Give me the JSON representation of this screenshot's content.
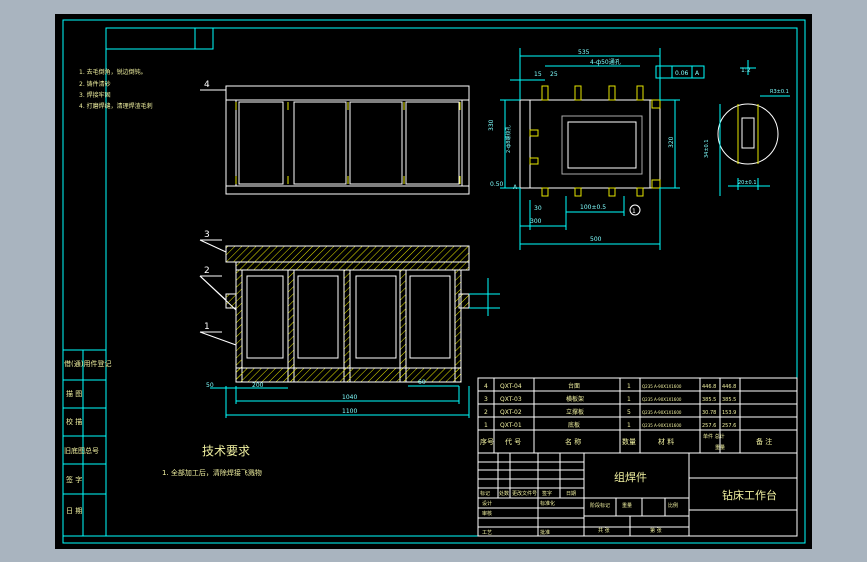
{
  "colors": {
    "background_outer": "#a9b4bf",
    "sheet": "#000000",
    "border": "#00ffff",
    "outline": "#ffffff",
    "hatch": "#e6e600",
    "dimension": "#00ffff",
    "text": "#f0f0a0"
  },
  "notes_top": [
    "1. 去毛倒角，锐边倒钝。",
    "2. 铸件清砂",
    "3. 焊接牢固",
    "4. 打磨焊缝，清理焊渣毛刺"
  ],
  "balloons": {
    "part4": "4",
    "part3": "3",
    "part2": "2",
    "part1": "1"
  },
  "tech_requirements": {
    "title": "技术要求",
    "line1": "1. 全部加工后，清除焊接飞溅物"
  },
  "dimensions": {
    "top_span": "535",
    "holes": "4-ф50通孔",
    "left_dim": "15",
    "small_25": "25",
    "left_height": "330",
    "side_holes": "2-ф8螺纹孔",
    "right_height": "320",
    "corner": "0.50",
    "dim_300": "300",
    "dim_100": "100±0.5",
    "dim_500": "500",
    "bottom_section_1040": "1040",
    "bottom_section_1100": "1100",
    "detail_12": "1:2",
    "detail_r": "R3±0.1",
    "detail_34": "34±0.1",
    "detail_w": "20±0.1",
    "flatness": "0.06",
    "flat_ref": "A",
    "dim_60": "60",
    "dim_30": "30",
    "dim_200": "200",
    "left_small": "50",
    "label_a": "A",
    "label_b": "1"
  },
  "bom_rows": [
    {
      "no": "4",
      "code": "QXT-04",
      "name": "台面",
      "qty": "1",
      "material": "Q235 A-90X1X1600",
      "weight": "446.8",
      "total": "446.8"
    },
    {
      "no": "3",
      "code": "QXT-03",
      "name": "横板架",
      "qty": "1",
      "material": "Q235 A-90X1X1600",
      "weight": "385.5",
      "total": "385.5"
    },
    {
      "no": "2",
      "code": "QXT-02",
      "name": "立撑板",
      "qty": "5",
      "material": "Q235 A-90X1X1600",
      "weight": "30.78",
      "total": "153.9"
    },
    {
      "no": "1",
      "code": "QXT-01",
      "name": "底板",
      "qty": "1",
      "material": "Q235 A-90X1X1600",
      "weight": "257.6",
      "total": "257.6"
    }
  ],
  "bom_header": {
    "no": "序号",
    "code": "代 号",
    "name": "名 称",
    "qty": "数量",
    "material": "材 料",
    "unit_total": "单件 总计",
    "weight_label": "重量",
    "remark": "备 注"
  },
  "title_block": {
    "assembly": "组焊件",
    "drawing_title": "钻床工作台",
    "mark": "标记",
    "count": "处数",
    "file": "更改文件号",
    "sign": "签字",
    "date": "日期",
    "designer": "设计",
    "standard": "标准化",
    "checker": "审核",
    "process": "工艺",
    "stage": "阶段标记",
    "weight": "重量",
    "scale": "比例",
    "sheet_total": "共 张",
    "sheet_no": "第 张",
    "approve": "批准"
  },
  "left_strip": [
    "借(通)用件登记",
    "描 图",
    "校 描",
    "旧底图总号",
    "签 字",
    "日 期"
  ]
}
